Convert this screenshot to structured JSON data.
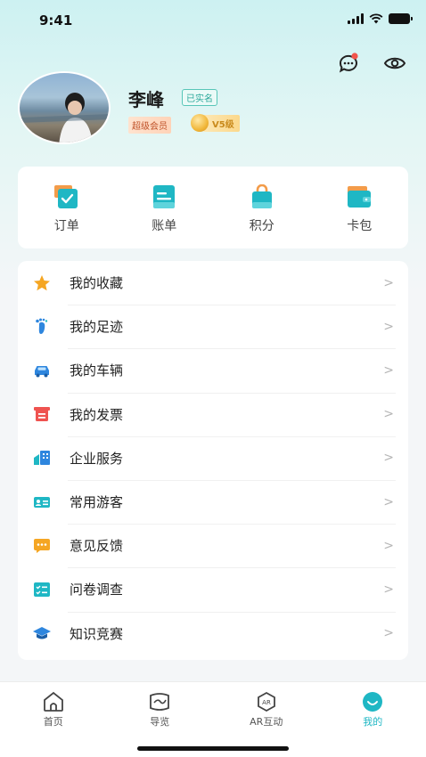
{
  "status_bar": {
    "time": "9:41"
  },
  "profile": {
    "name": "李峰",
    "verified_label": "已实名",
    "vip_label": "超级会员",
    "level_label": "V5级"
  },
  "quick_actions": [
    {
      "label": "订单",
      "icon": "order-icon",
      "color": "#1fb7c4"
    },
    {
      "label": "账单",
      "icon": "bill-icon",
      "color": "#1fb7c4"
    },
    {
      "label": "积分",
      "icon": "points-bag-icon",
      "color": "#1fb7c4"
    },
    {
      "label": "卡包",
      "icon": "card-wallet-icon",
      "color": "#1fb7c4"
    }
  ],
  "menu": [
    {
      "label": "我的收藏",
      "icon": "star-icon",
      "color": "#f5a623"
    },
    {
      "label": "我的足迹",
      "icon": "footprint-icon",
      "color": "#2e86de"
    },
    {
      "label": "我的车辆",
      "icon": "car-icon",
      "color": "#2e86de"
    },
    {
      "label": "我的发票",
      "icon": "invoice-icon",
      "color": "#ef5350"
    },
    {
      "label": "企业服务",
      "icon": "building-icon",
      "color": "#2e86de"
    },
    {
      "label": "常用游客",
      "icon": "id-card-icon",
      "color": "#1fb7c4"
    },
    {
      "label": "意见反馈",
      "icon": "chat-bubble-icon",
      "color": "#f5a623"
    },
    {
      "label": "问卷调查",
      "icon": "checklist-icon",
      "color": "#1fb7c4"
    },
    {
      "label": "知识竞赛",
      "icon": "graduation-cap-icon",
      "color": "#2e86de"
    }
  ],
  "tabs": [
    {
      "label": "首页",
      "icon": "home-icon",
      "active": false
    },
    {
      "label": "导览",
      "icon": "map-guide-icon",
      "active": false
    },
    {
      "label": "AR互动",
      "icon": "ar-icon",
      "active": false
    },
    {
      "label": "我的",
      "icon": "profile-face-icon",
      "active": true
    }
  ],
  "colors": {
    "accent": "#1fb7c4",
    "text": "#222222"
  }
}
